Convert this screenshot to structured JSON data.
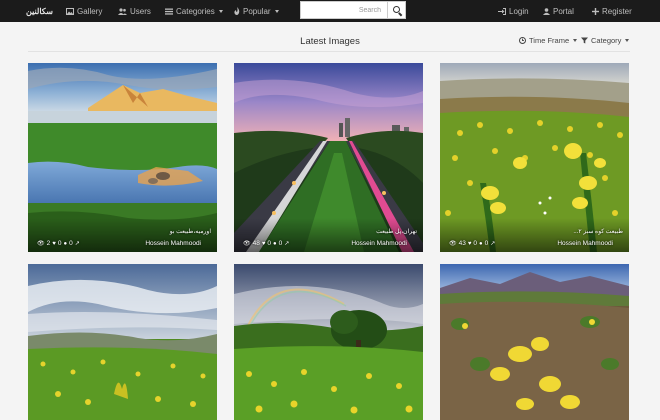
{
  "nav": {
    "brand": "سكالنين",
    "gallery": "Gallery",
    "users": "Users",
    "categories": "Categories",
    "popular": "Popular",
    "login": "Login",
    "portal": "Portal",
    "register": "Register"
  },
  "search": {
    "placeholder": "Search"
  },
  "header": {
    "title": "Latest Images",
    "time_frame": "Time Frame",
    "category": "Category"
  },
  "images": [
    {
      "title": "اورمیه،طبیعت بو",
      "author": "Hossein Mahmoodi",
      "views": "2",
      "likes": "0",
      "comments": "0"
    },
    {
      "title": "تهران،پل طبیعت",
      "author": "Hossein Mahmoodi",
      "views": "48",
      "likes": "0",
      "comments": "0"
    },
    {
      "title": "طبیعت کوه سبز ۲...",
      "author": "Hossein Mahmoodi",
      "views": "43",
      "likes": "0",
      "comments": "0"
    },
    {
      "title": "",
      "author": "",
      "views": "",
      "likes": "",
      "comments": ""
    },
    {
      "title": "",
      "author": "",
      "views": "",
      "likes": "",
      "comments": ""
    },
    {
      "title": "",
      "author": "",
      "views": "",
      "likes": "",
      "comments": ""
    }
  ],
  "colors": {
    "navbar": "#1b1b1b",
    "page_bg": "#f4f4f4",
    "nav_text": "#bdbdbd"
  },
  "icons": {
    "gallery": "picture-icon",
    "users": "users-icon",
    "categories": "list-icon",
    "popular": "fire-icon",
    "login": "sign-in-icon",
    "portal": "user-icon",
    "register": "plus-icon",
    "search": "search-icon",
    "time": "clock-icon",
    "category": "filter-icon",
    "views": "eye-icon",
    "likes": "heart-icon",
    "comments": "comment-icon",
    "share": "external-link-icon"
  }
}
